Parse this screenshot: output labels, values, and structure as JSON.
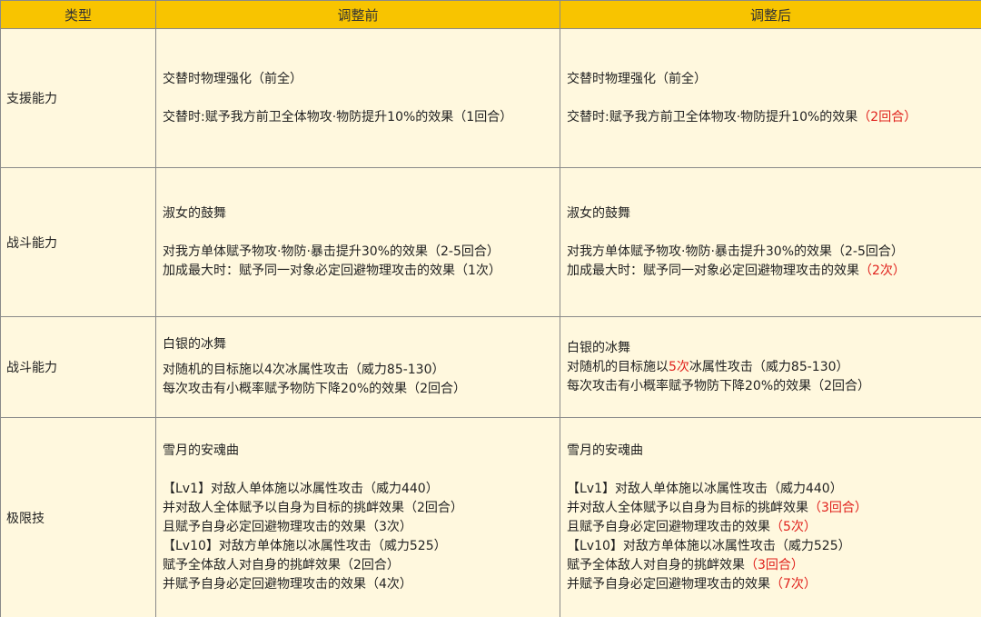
{
  "headers": {
    "type": "类型",
    "before": "调整前",
    "after": "调整后"
  },
  "rows": [
    {
      "type": "支援能力",
      "before": {
        "title": "交替时物理强化（前全）",
        "l1": "交替时:赋予我方前卫全体物攻·物防提升10%的效果（1回合）"
      },
      "after": {
        "title": "交替时物理强化（前全）",
        "l1_pre": "交替时:赋予我方前卫全体物攻·物防提升10%的效果",
        "l1_red": "（2回合）"
      }
    },
    {
      "type": "战斗能力",
      "before": {
        "title": "淑女的鼓舞",
        "l1": "对我方单体赋予物攻·物防·暴击提升30%的效果（2-5回合）",
        "l2": "加成最大时：赋予同一对象必定回避物理攻击的效果（1次）"
      },
      "after": {
        "title": "淑女的鼓舞",
        "l1": "对我方单体赋予物攻·物防·暴击提升30%的效果（2-5回合）",
        "l2_pre": "加成最大时：赋予同一对象必定回避物理攻击的效果",
        "l2_red": "（2次）"
      }
    },
    {
      "type": "战斗能力",
      "before": {
        "title": "白银的冰舞",
        "l1": "对随机的目标施以4次冰属性攻击（威力85-130）",
        "l2": "每次攻击有小概率赋予物防下降20%的效果（2回合）"
      },
      "after": {
        "title": "白银的冰舞",
        "l1_pre": "对随机的目标施以",
        "l1_red": "5次",
        "l1_post": "冰属性攻击（威力85-130）",
        "l2": "每次攻击有小概率赋予物防下降20%的效果（2回合）"
      }
    },
    {
      "type": "极限技",
      "before": {
        "title": "雪月的安魂曲",
        "l1": "【Lv1】对敌人单体施以冰属性攻击（威力440）",
        "l2": "并对敌人全体赋予以自身为目标的挑衅效果（2回合）",
        "l3": "且赋予自身必定回避物理攻击的效果（3次）",
        "l4": "【Lv10】对敌方单体施以冰属性攻击（威力525）",
        "l5": "赋予全体敌人对自身的挑衅效果（2回合）",
        "l6": "并赋予自身必定回避物理攻击的效果（4次）"
      },
      "after": {
        "title": "雪月的安魂曲",
        "l1": "【Lv1】对敌人单体施以冰属性攻击（威力440）",
        "l2_pre": "并对敌人全体赋予以自身为目标的挑衅效果",
        "l2_red": "（3回合）",
        "l3_pre": "且赋予自身必定回避物理攻击的效果",
        "l3_red": "（5次）",
        "l4": "【Lv10】对敌方单体施以冰属性攻击（威力525）",
        "l5_pre": "赋予全体敌人对自身的挑衅效果",
        "l5_red": "（3回合）",
        "l6_pre": "并赋予自身必定回避物理攻击的效果",
        "l6_red": "（7次）"
      }
    }
  ],
  "colors": {
    "header_bg": "#f8c400",
    "cell_bg": "#fff8de",
    "highlight": "#e0201b"
  }
}
